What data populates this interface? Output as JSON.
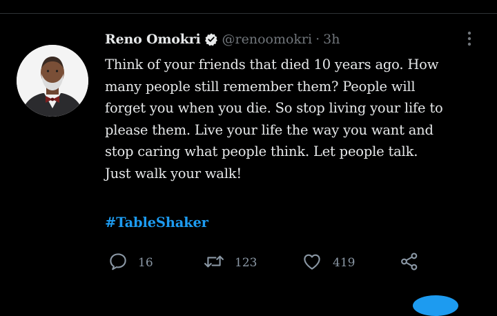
{
  "tweet": {
    "author": {
      "display_name": "Reno Omokri",
      "handle": "@renoomokri",
      "verified": true
    },
    "separator": "·",
    "time": "3h",
    "text_lines": [
      "Think of your friends that died 10 years ago. How",
      "many people still remember them? People will",
      "forget you when you die. So stop living your life to",
      "please them. Live your life the way you want and",
      "stop caring what people think. Let people talk.",
      "Just walk your walk!"
    ],
    "hashtag": "#TableShaker",
    "stats": {
      "replies": "16",
      "retweets": "123",
      "likes": "419"
    }
  },
  "icons": {
    "verified": "verified-badge-icon",
    "more": "more-vertical-icon",
    "reply": "reply-icon",
    "retweet": "retweet-icon",
    "like": "heart-icon",
    "share": "share-icon"
  },
  "colors": {
    "background": "#000000",
    "text": "#e7e9ea",
    "muted": "#71767b",
    "accent": "#1d9bf0"
  }
}
